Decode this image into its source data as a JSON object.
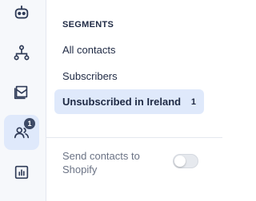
{
  "rail": {
    "items": [
      {
        "icon": "robot-icon"
      },
      {
        "icon": "hierarchy-icon"
      },
      {
        "icon": "envelope-icon"
      },
      {
        "icon": "contacts-icon",
        "badge": "1",
        "active": true
      },
      {
        "icon": "bar-chart-icon"
      }
    ]
  },
  "segments": {
    "heading": "SEGMENTS",
    "items": [
      {
        "label": "All contacts"
      },
      {
        "label": "Subscribers"
      },
      {
        "label": "Unsubscribed in Ireland",
        "count": "1",
        "active": true
      }
    ]
  },
  "shopify_toggle": {
    "label": "Send contacts to Shopify",
    "enabled": false
  },
  "colors": {
    "accent_bg": "#dfe9fb",
    "icon": "#2f3b57",
    "badge": "#3d4a66"
  }
}
